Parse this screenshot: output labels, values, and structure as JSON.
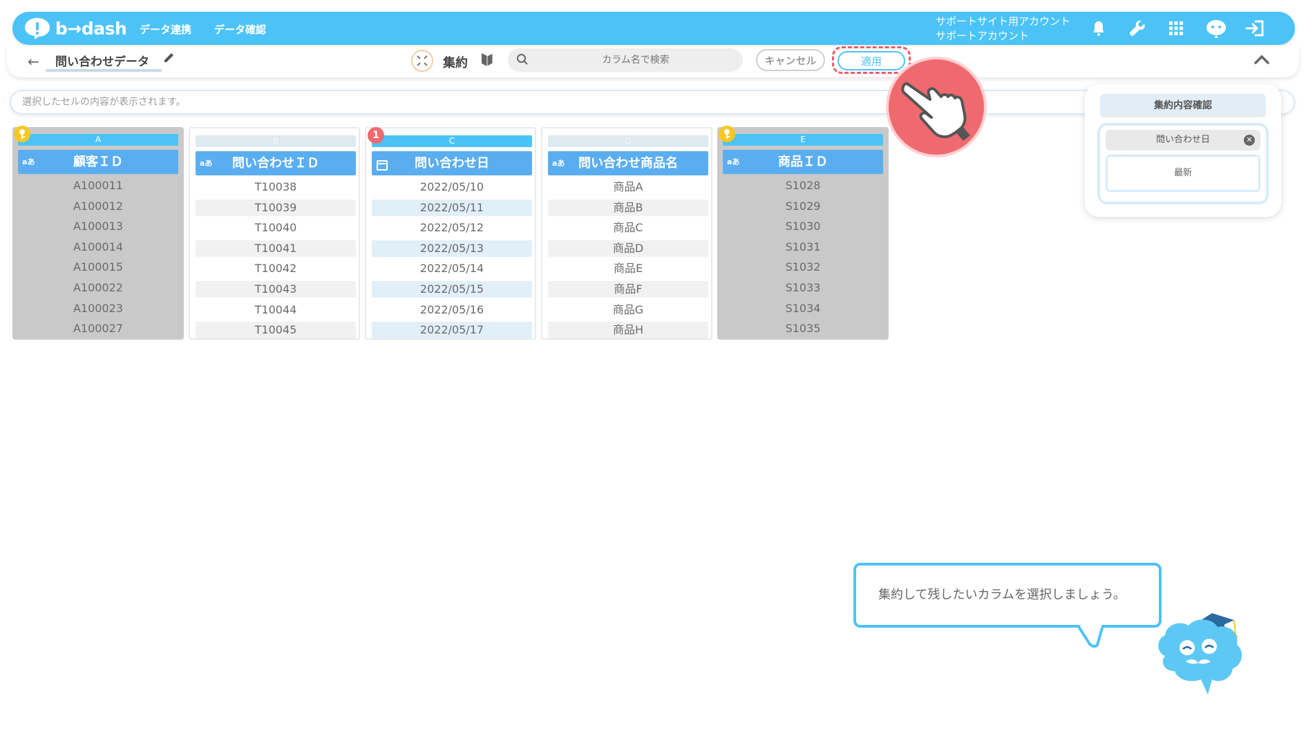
{
  "app": {
    "logo_text": "b→dash"
  },
  "nav": {
    "links": [
      "データ連携",
      "データ確認"
    ],
    "account_line1": "サポートサイト用アカウント",
    "account_line2": "サポートアカウント"
  },
  "toolbar": {
    "dataset_name": "問い合わせデータ",
    "mode_label": "集約",
    "search_placeholder": "カラム名で検索",
    "cancel_label": "キャンセル",
    "apply_label": "適用"
  },
  "cell_bar": {
    "placeholder": "選択したセルの内容が表示されます。"
  },
  "columns": [
    {
      "letter": "A",
      "type": "aあ",
      "header": "顧客ＩＤ",
      "selected": true,
      "cells": [
        "A100011",
        "A100012",
        "A100013",
        "A100014",
        "A100015",
        "A100022",
        "A100023",
        "A100027"
      ]
    },
    {
      "letter": "B",
      "type": "aあ",
      "header": "問い合わせＩＤ",
      "selected": false,
      "cells": [
        "T10038",
        "T10039",
        "T10040",
        "T10041",
        "T10042",
        "T10043",
        "T10044",
        "T10045"
      ]
    },
    {
      "letter": "C",
      "type": "calendar",
      "badge": "1",
      "header": "問い合わせ日",
      "selected": false,
      "cells": [
        "2022/05/10",
        "2022/05/11",
        "2022/05/12",
        "2022/05/13",
        "2022/05/14",
        "2022/05/15",
        "2022/05/16",
        "2022/05/17"
      ]
    },
    {
      "letter": "D",
      "type": "aあ",
      "header": "問い合わせ商品名",
      "selected": false,
      "cells": [
        "商品A",
        "商品B",
        "商品C",
        "商品D",
        "商品E",
        "商品F",
        "商品G",
        "商品H"
      ]
    },
    {
      "letter": "E",
      "type": "aあ",
      "header": "商品ＩＤ",
      "selected": true,
      "cells": [
        "S1028",
        "S1029",
        "S1030",
        "S1031",
        "S1032",
        "S1033",
        "S1034",
        "S1035"
      ]
    }
  ],
  "agg_panel": {
    "title": "集約内容確認",
    "chip_label": "問い合わせ日",
    "method": "最新"
  },
  "tooltip": {
    "text": "集約して残したいカラムを選択しましょう。"
  },
  "colors": {
    "accent": "#4cc3f7",
    "header_blue": "#5aaef0",
    "key_yellow": "#f7c823",
    "alert_red": "#ef6a6e",
    "selected_gray": "#c9c9c9"
  }
}
